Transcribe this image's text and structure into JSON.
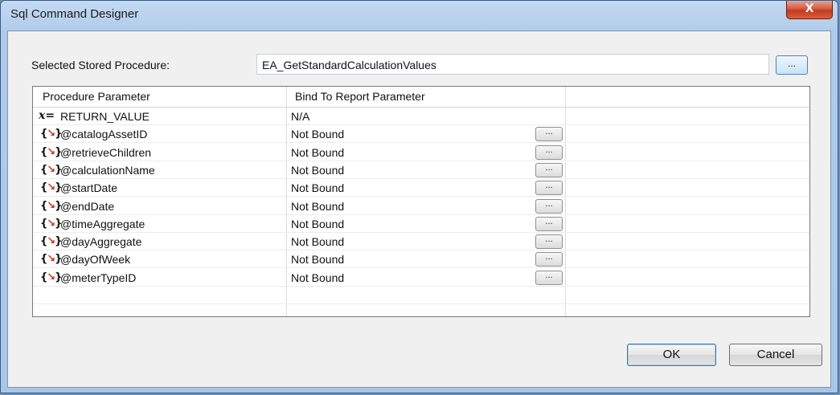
{
  "window": {
    "title": "Sql Command Designer",
    "close_glyph": "X"
  },
  "stored_procedure": {
    "label": "Selected Stored Procedure:",
    "value": "EA_GetStandardCalculationValues",
    "browse_label": "..."
  },
  "grid": {
    "columns": [
      "Procedure Parameter",
      "Bind To Report Parameter"
    ],
    "rows": [
      {
        "icon": "x-equals-icon",
        "name": "RETURN_VALUE",
        "binding": "N/A",
        "has_button": false
      },
      {
        "icon": "parameter-icon",
        "name": "@catalogAssetID",
        "binding": "Not Bound",
        "has_button": true
      },
      {
        "icon": "parameter-icon",
        "name": "@retrieveChildren",
        "binding": "Not Bound",
        "has_button": true
      },
      {
        "icon": "parameter-icon",
        "name": "@calculationName",
        "binding": "Not Bound",
        "has_button": true
      },
      {
        "icon": "parameter-icon",
        "name": "@startDate",
        "binding": "Not Bound",
        "has_button": true
      },
      {
        "icon": "parameter-icon",
        "name": "@endDate",
        "binding": "Not Bound",
        "has_button": true
      },
      {
        "icon": "parameter-icon",
        "name": "@timeAggregate",
        "binding": "Not Bound",
        "has_button": true
      },
      {
        "icon": "parameter-icon",
        "name": "@dayAggregate",
        "binding": "Not Bound",
        "has_button": true
      },
      {
        "icon": "parameter-icon",
        "name": "@dayOfWeek",
        "binding": "Not Bound",
        "has_button": true
      },
      {
        "icon": "parameter-icon",
        "name": "@meterTypeID",
        "binding": "Not Bound",
        "has_button": true
      }
    ],
    "row_button_label": "..."
  },
  "buttons": {
    "ok": "OK",
    "cancel": "Cancel"
  }
}
